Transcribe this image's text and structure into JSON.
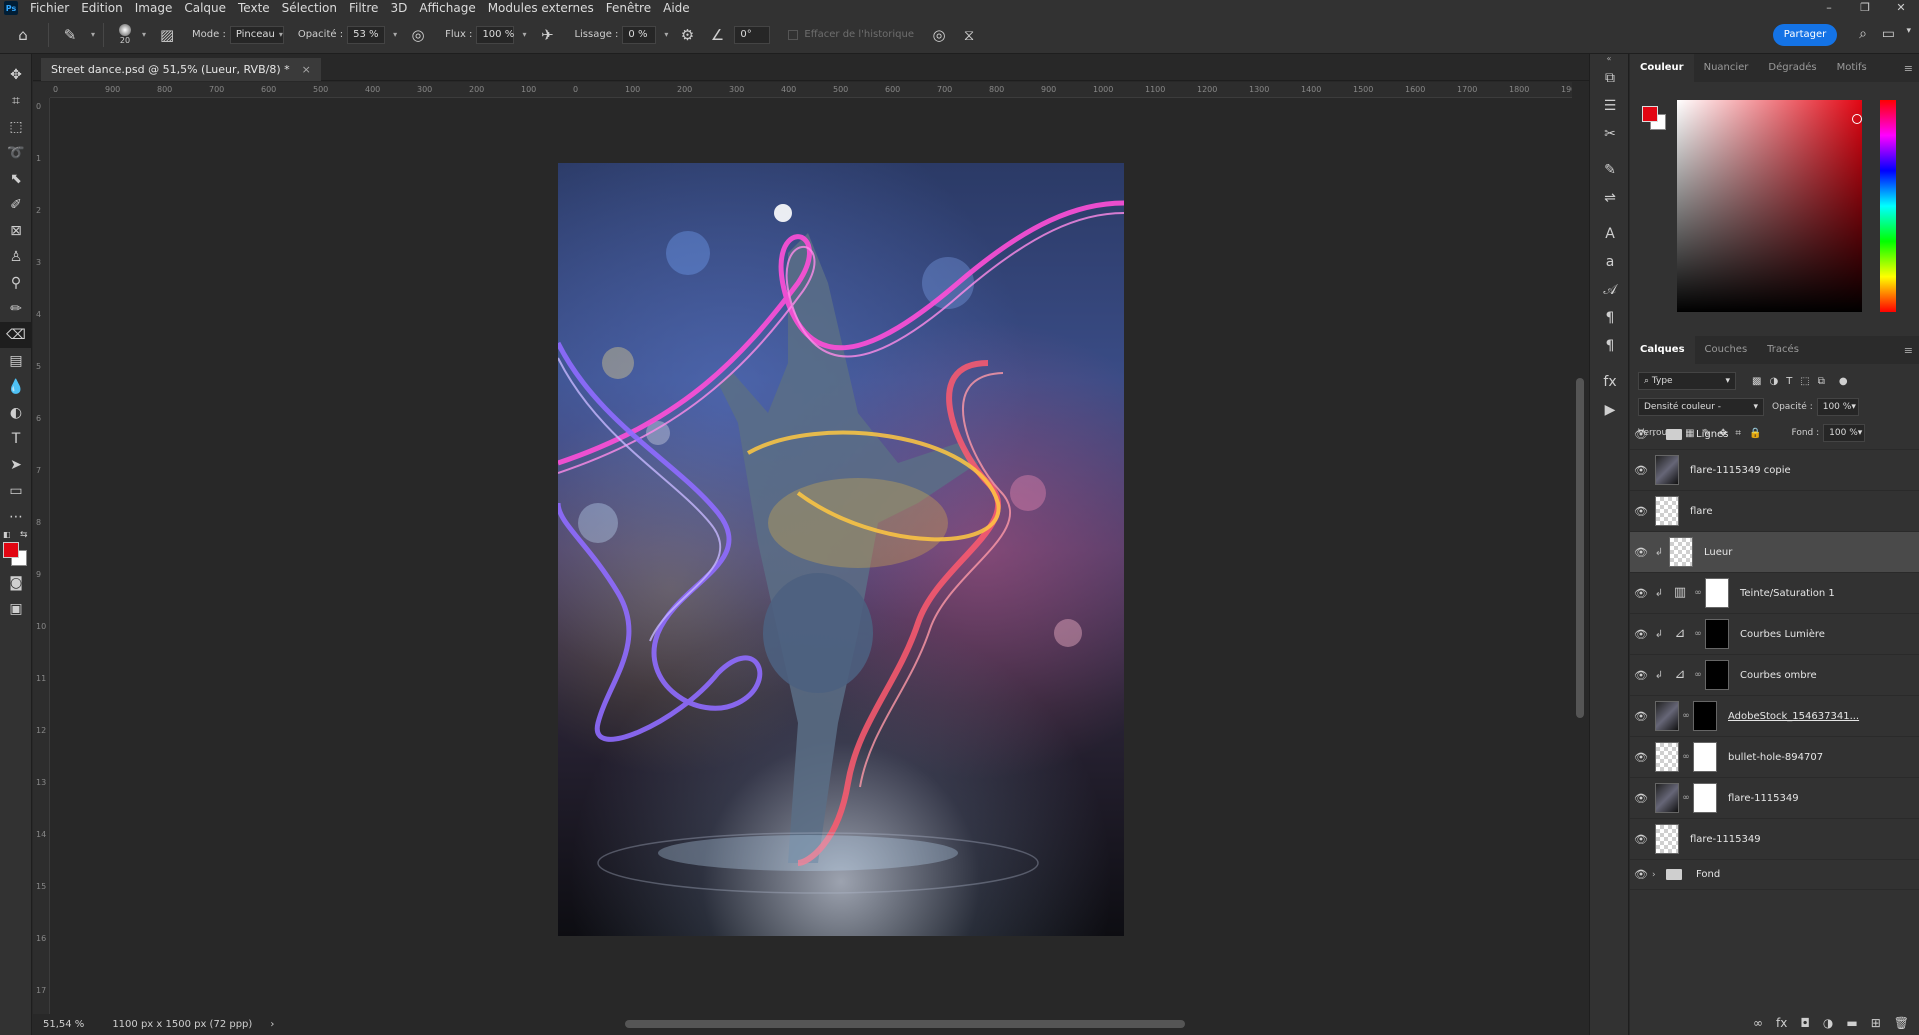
{
  "app": {
    "logo": "Ps"
  },
  "menu": [
    "Fichier",
    "Edition",
    "Image",
    "Calque",
    "Texte",
    "Sélection",
    "Filtre",
    "3D",
    "Affichage",
    "Modules externes",
    "Fenêtre",
    "Aide"
  ],
  "window_controls": {
    "minimize": "–",
    "restore": "❐",
    "close": "✕"
  },
  "options": {
    "brush_size": "20",
    "mode_label": "Mode :",
    "mode_value": "Pinceau",
    "opacity_label": "Opacité :",
    "opacity_value": "53 %",
    "flux_label": "Flux :",
    "flux_value": "100 %",
    "lissage_label": "Lissage :",
    "lissage_value": "0 %",
    "angle_value": "0°",
    "history_label": "Effacer de l'historique",
    "share_label": "Partager"
  },
  "document": {
    "tab_title": "Street dance.psd @ 51,5% (Lueur, RVB/8) *",
    "close": "×",
    "zoom": "51,54 %",
    "dimensions": "1100 px x 1500 px (72 ppp)"
  },
  "rulers": {
    "h_labels": [
      "0",
      "900",
      "800",
      "700",
      "600",
      "500",
      "400",
      "300",
      "200",
      "100",
      "0",
      "100",
      "200",
      "300",
      "400",
      "500",
      "600",
      "700",
      "800",
      "900",
      "1000",
      "1100",
      "1200",
      "1300",
      "1400",
      "1500",
      "1600",
      "1700",
      "1800",
      "1900"
    ],
    "v_labels": [
      "0",
      "1",
      "2",
      "3",
      "4",
      "5",
      "6",
      "7",
      "8",
      "9",
      "10",
      "11",
      "12",
      "13",
      "14",
      "15",
      "16",
      "17"
    ]
  },
  "color_panel": {
    "tabs": [
      "Couleur",
      "Nuancier",
      "Dégradés",
      "Motifs"
    ],
    "active_tab": "Couleur",
    "fg_color": "#e20613",
    "bg_color": "#ffffff"
  },
  "layers_panel": {
    "tabs": [
      "Calques",
      "Couches",
      "Tracés"
    ],
    "active_tab": "Calques",
    "filter_label": "Type",
    "blend_mode": "Densité couleur -",
    "opacity_label": "Opacité :",
    "opacity_value": "100 %",
    "lock_label": "Verrou :",
    "fill_label": "Fond :",
    "fill_value": "100 %",
    "layers": [
      {
        "name": "Lignes",
        "kind": "folder"
      },
      {
        "name": "flare-1115349 copie",
        "kind": "pixel-dark"
      },
      {
        "name": "flare",
        "kind": "pixel"
      },
      {
        "name": "Lueur",
        "kind": "pixel",
        "selected": true,
        "clip": true
      },
      {
        "name": "Teinte/Saturation 1",
        "kind": "adjustment",
        "clip": true,
        "mask": "white"
      },
      {
        "name": "Courbes Lumière",
        "kind": "adjustment",
        "clip": true,
        "mask": "black"
      },
      {
        "name": "Courbes ombre",
        "kind": "adjustment",
        "clip": true,
        "mask": "black"
      },
      {
        "name": "AdobeStock_154637341...",
        "kind": "masked",
        "mask": "black"
      },
      {
        "name": "bullet-hole-894707",
        "kind": "masked",
        "mask": "white"
      },
      {
        "name": "flare-1115349",
        "kind": "masked-dark",
        "mask": "white"
      },
      {
        "name": "flare-1115349",
        "kind": "pixel"
      },
      {
        "name": "Fond",
        "kind": "folder"
      }
    ]
  }
}
